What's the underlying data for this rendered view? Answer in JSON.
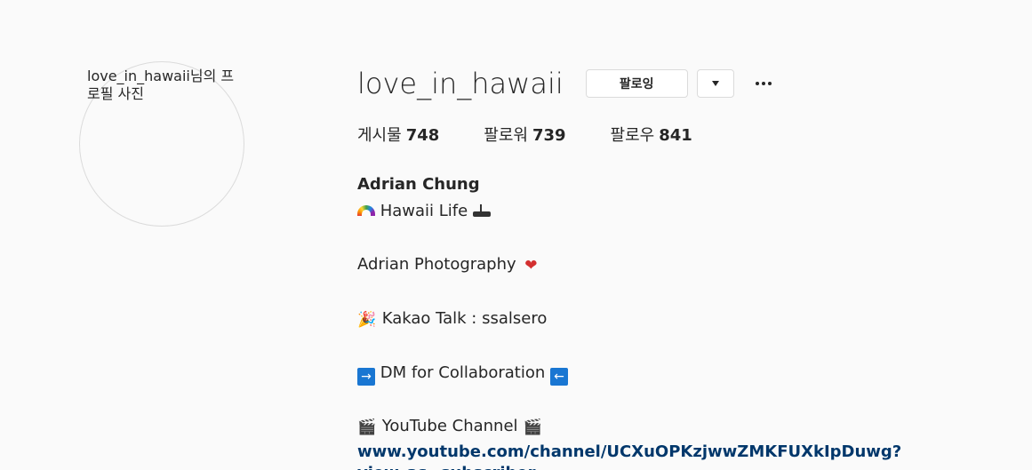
{
  "avatar": {
    "alt_text": "love_in_hawaii님의 프로필 사진"
  },
  "profile": {
    "username": "love_in_hawaii",
    "follow_button_label": "팔로잉",
    "dropdown_icon": "triangle-down-icon",
    "more_icon": "more-options-icon"
  },
  "stats": {
    "posts": {
      "label": "게시물",
      "count": "748"
    },
    "followers": {
      "label": "팔로워",
      "count": "739"
    },
    "following": {
      "label": "팔로우",
      "count": "841"
    }
  },
  "bio": {
    "full_name": "Adrian Chung",
    "line1_text": " Hawaii Life ",
    "line2_text": "Adrian Photography ",
    "line3_text": " Kakao Talk : ssalsero",
    "line4_text": " DM for Collaboration ",
    "line5_text": " YouTube Channel ",
    "emoji_heart": "❤",
    "emoji_party": "🎉",
    "emoji_right_arrow": "→",
    "emoji_left_arrow": "←",
    "emoji_clapper": "🎬",
    "link": "www.youtube.com/channel/UCXuOPKzjwwZMKFUXkIpDuwg?view_as=subscriber"
  },
  "colors": {
    "background": "#fafafa",
    "text": "#262626",
    "link": "#00376b",
    "border": "#dbdbdb"
  }
}
